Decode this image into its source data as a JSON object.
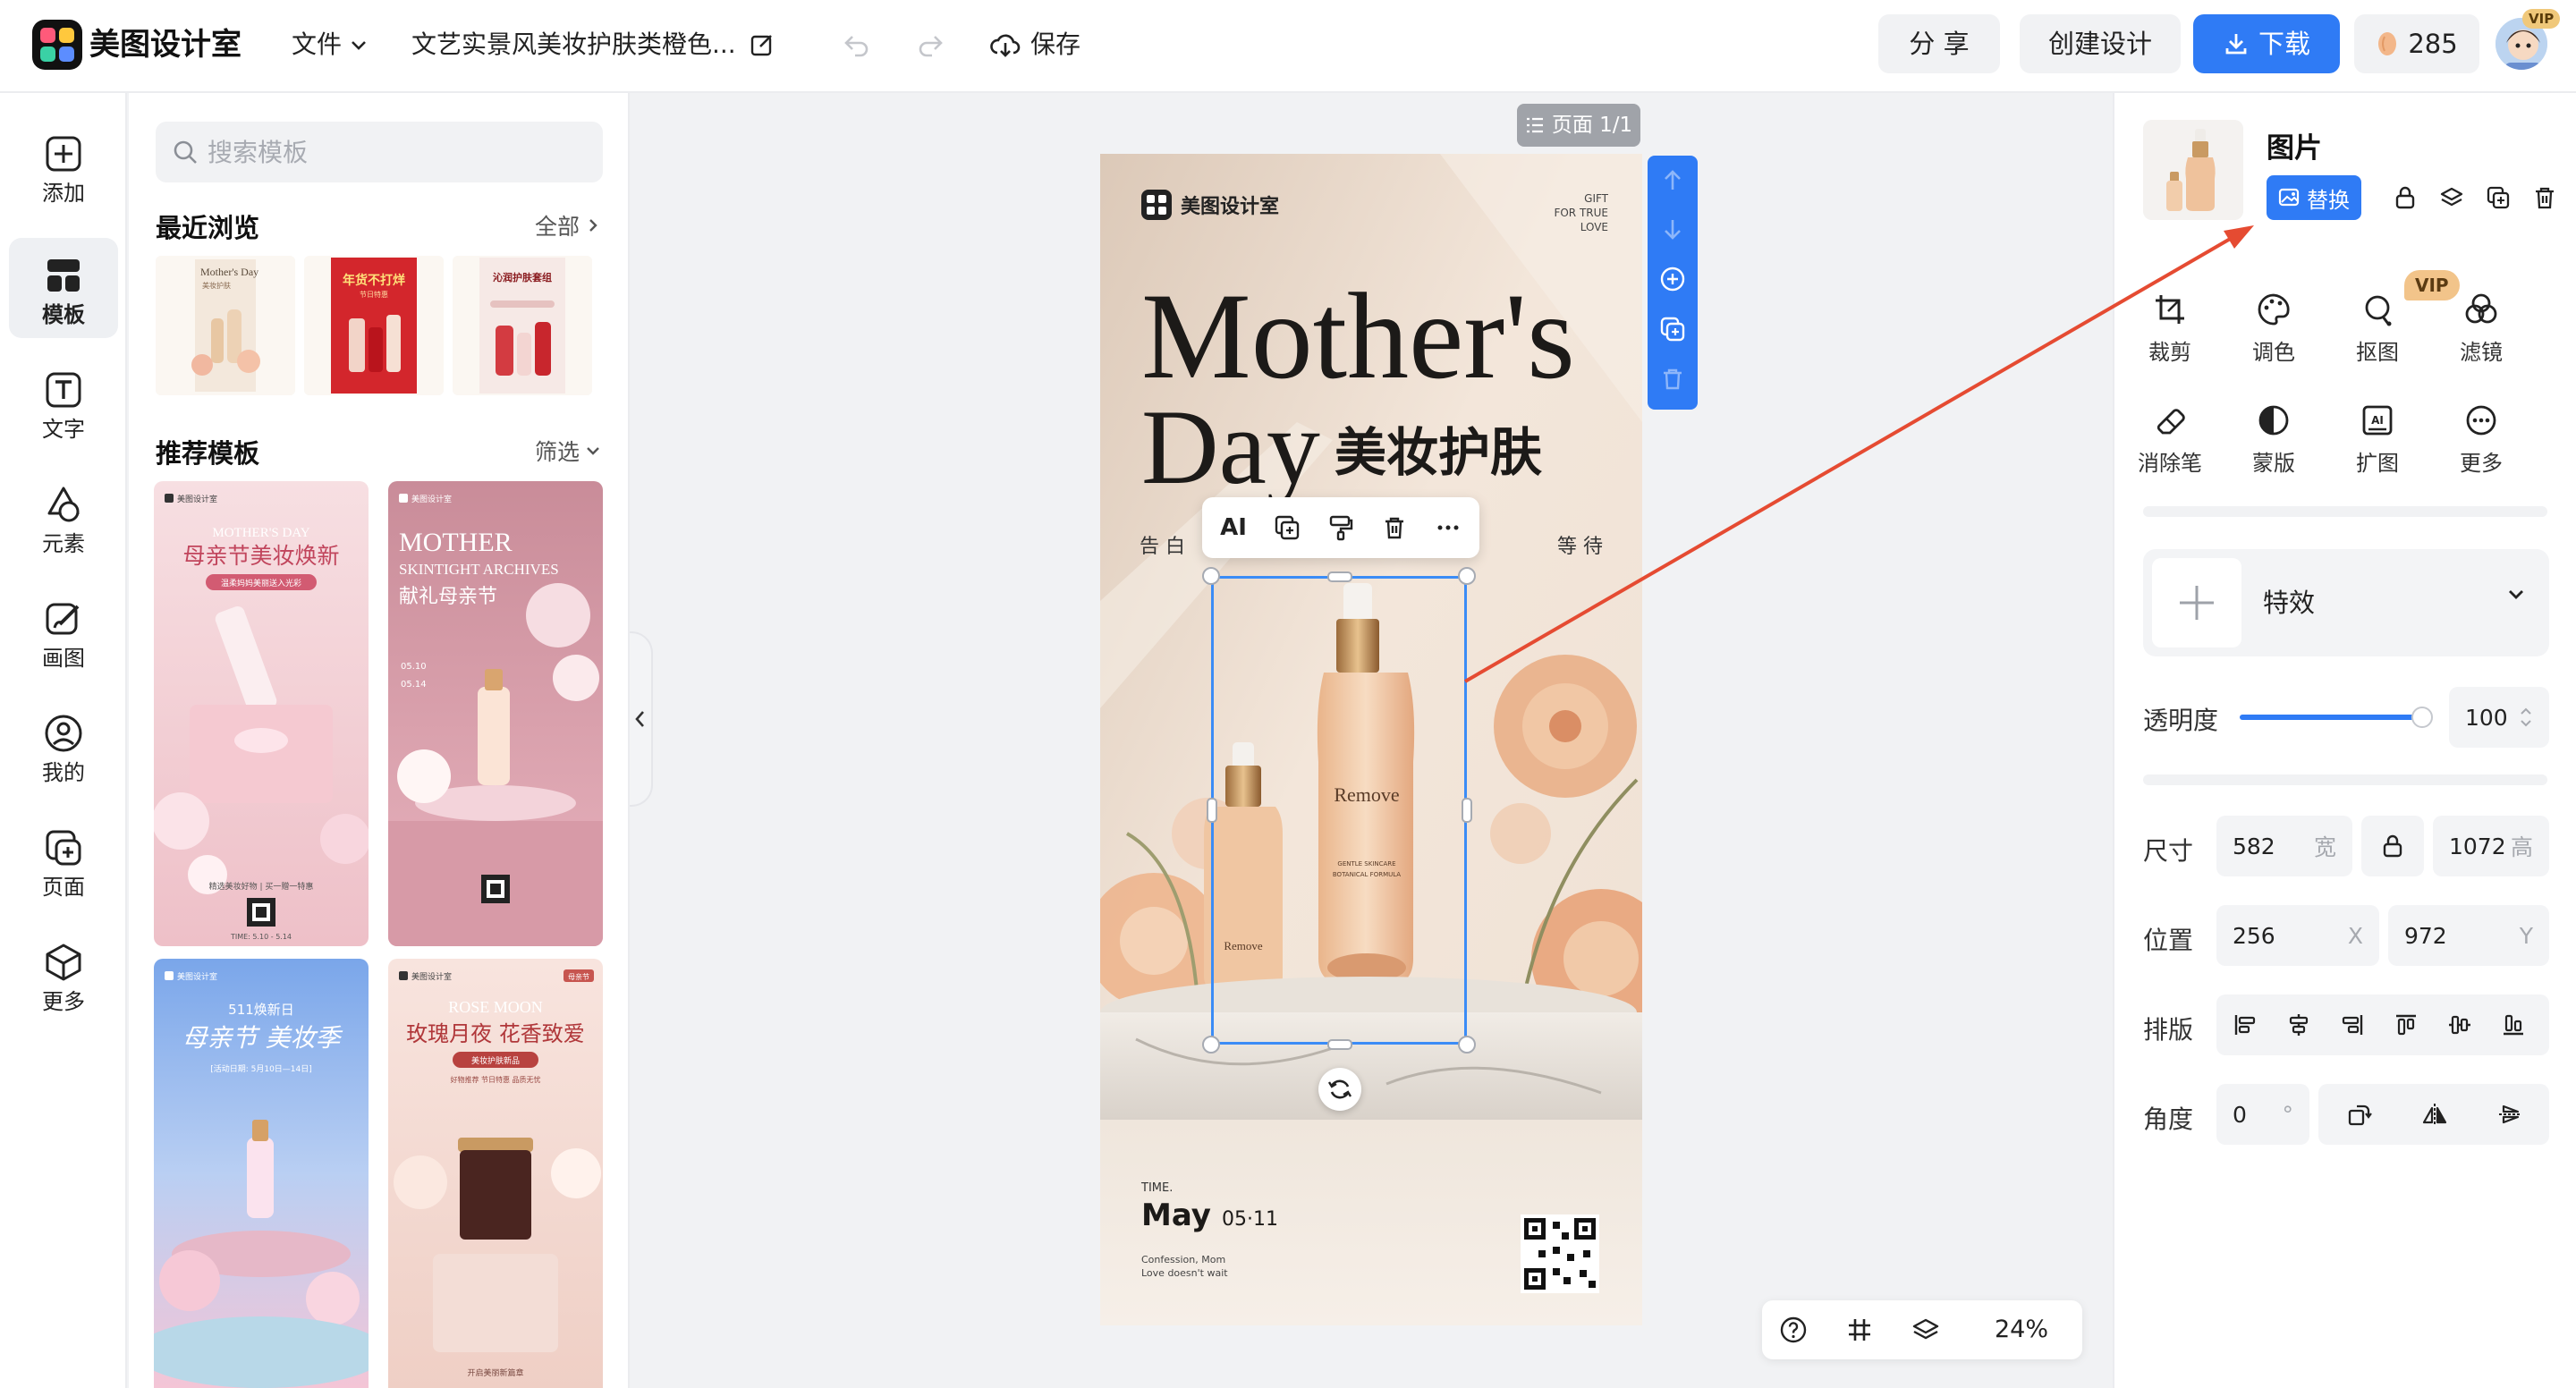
{
  "topbar": {
    "app_name": "美图设计室",
    "file_menu": "文件",
    "doc_title": "文艺实景风美妆护肤类橙色...",
    "save": "保存",
    "share": "分 享",
    "create": "创建设计",
    "download": "下载",
    "beans": "285",
    "vip": "VIP"
  },
  "leftrail": {
    "items": [
      "添加",
      "模板",
      "文字",
      "元素",
      "画图",
      "我的",
      "页面",
      "更多"
    ],
    "active": "模板"
  },
  "panel": {
    "search_placeholder": "搜索模板",
    "recent_title": "最近浏览",
    "recent_link": "全部",
    "recommend_title": "推荐模板",
    "recommend_link": "筛选",
    "recent_thumbs": [
      {
        "title": "Mother's Day",
        "sub": "美妆护肤"
      },
      {
        "title": "年货不打烊",
        "sub": "节日特惠"
      },
      {
        "title": "沁润护肤套组",
        "sub": ""
      }
    ],
    "templates": [
      {
        "brand": "美图设计室",
        "en": "MOTHER'S DAY",
        "title": "母亲节美妆焕新",
        "sub": "温柔妈妈美丽送入光彩",
        "foot": "精选美妆好物 | 买一赠一特惠",
        "foot2": "TIME: 5.10 - 5.14"
      },
      {
        "brand": "美图设计室",
        "en": "MOTHER",
        "en2": "SKINTIGHT ARCHIVES",
        "title": "献礼母亲节",
        "date1": "05.10",
        "date2": "05.14"
      },
      {
        "brand": "美图设计室",
        "en": "511焕新日",
        "title": "母亲节 美妆季",
        "sub": "[活动日期: 5月10日—14日]"
      },
      {
        "brand": "美图设计室",
        "tag": "母亲节",
        "en": "ROSE MOON",
        "title": "玫瑰月夜 花香致爱",
        "sub": "美妆护肤新品",
        "sub2": "好物推荐 节日特惠 品质无忧",
        "foot": "开启美丽新篇章"
      }
    ]
  },
  "canvas": {
    "page_label": "页面 1/1",
    "zoom": "24%",
    "float_ai": "AI"
  },
  "poster": {
    "brand": "美图设计室",
    "gift_lines": [
      "GIFT",
      "FOR TRUE",
      "LOVE"
    ],
    "title_line1": "Mother's",
    "title_line2_en": "Day",
    "title_line2_cn": "美妆护肤",
    "sub_left": "告  白",
    "sub_right": "等  待",
    "bottle_label_big": "Remove",
    "bottle_small1": "GENTLE SKINCARE",
    "bottle_small2": "BOTANICAL FORMULA",
    "bottle_label_small": "Remove",
    "time_label": "TIME.",
    "month": "May",
    "date": "05·11",
    "confession1": "Confession, Mom",
    "confession2": "Love doesn't wait"
  },
  "rpanel": {
    "title": "图片",
    "replace": "替换",
    "vip": "VIP",
    "tools_row1": [
      "裁剪",
      "调色",
      "抠图",
      "滤镜"
    ],
    "tools_row2": [
      "消除笔",
      "蒙版",
      "扩图",
      "更多"
    ],
    "effect": "特效",
    "opacity_label": "透明度",
    "opacity_value": "100",
    "opacity_fraction": 1.0,
    "size_label": "尺寸",
    "width": "582",
    "width_suffix": "宽",
    "height": "1072",
    "height_suffix": "高",
    "pos_label": "位置",
    "x": "256",
    "x_suffix": "X",
    "y": "972",
    "y_suffix": "Y",
    "arrange_label": "排版",
    "angle_label": "角度",
    "angle": "0",
    "angle_suffix": "°"
  },
  "colors": {
    "accent": "#2f7bf5",
    "annotation_arrow": "#e54b32",
    "selection": "#3b8cf6"
  }
}
